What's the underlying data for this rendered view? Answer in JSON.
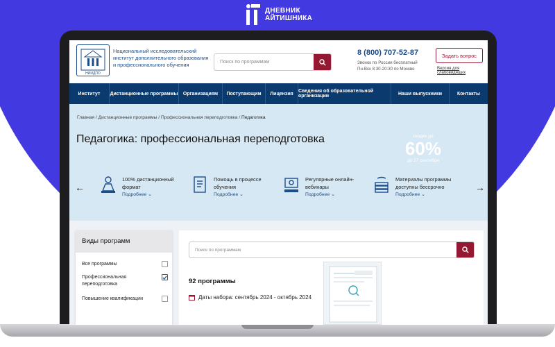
{
  "brand": {
    "line1": "ДНЕВНИК",
    "line2": "АЙТИШНИКА"
  },
  "header": {
    "logo_text": "НИИДПО",
    "org_name": "Национальный исследовательский институт дополнительного образования и профессионального обучения",
    "search_placeholder": "Поиск по программам",
    "phone": "8 (800) 707-52-87",
    "phone_note1": "Звонок по России бесплатный",
    "phone_note2": "Пн-Вск 8:30-20:30 по Москве",
    "ask_button": "Задать вопрос",
    "vision_link": "Версия для слабовидящих"
  },
  "nav": [
    {
      "label": "Институт",
      "w": 0
    },
    {
      "label": "Дистанционные программы"
    },
    {
      "label": "Организациям"
    },
    {
      "label": "Поступающим"
    },
    {
      "label": "Лицензия"
    },
    {
      "label": "Сведения об образовательной организации"
    },
    {
      "label": "Наши выпускники"
    },
    {
      "label": "Контакты"
    }
  ],
  "breadcrumbs": [
    "Главная",
    "Дистанционные программы",
    "Профессиональная переподготовка",
    "Педагогика"
  ],
  "page_title": "Педагогика: профессиональная переподготовка",
  "discount": {
    "top": "скидки до",
    "value": "60%",
    "bottom": "до 27 сентября"
  },
  "features": [
    {
      "line1": "100% дистанционный",
      "line2": "формат",
      "more": "Подробнее"
    },
    {
      "line1": "Помощь в процессе",
      "line2": "обучения",
      "more": "Подробнее"
    },
    {
      "line1": "Регулярные онлайн-",
      "line2": "вебинары",
      "more": "Подробнее"
    },
    {
      "line1": "Материалы программы",
      "line2": "доступны бессрочно",
      "more": "Подробнее"
    }
  ],
  "sidebar": {
    "title": "Виды программ",
    "filters": [
      {
        "label": "Все программы",
        "checked": false
      },
      {
        "label": "Профессиональная переподготовка",
        "checked": true
      },
      {
        "label": "Повышение квалификации",
        "checked": false
      }
    ]
  },
  "content": {
    "search_placeholder": "Поиск по программам",
    "count": "92 программы",
    "dates": "Даты набора: сентябрь 2024 - октябрь 2024"
  },
  "colors": {
    "accent": "#951832",
    "navy": "#0b3a6e",
    "hero": "#d6e8f3",
    "background": "#4339e0"
  }
}
